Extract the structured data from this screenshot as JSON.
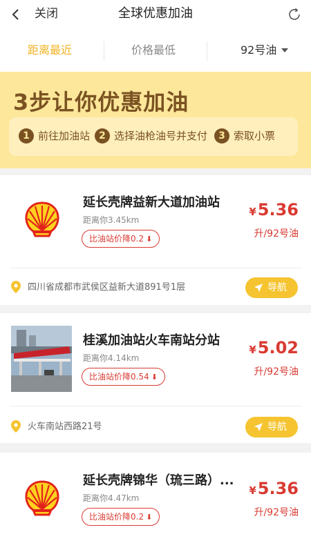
{
  "header": {
    "close_label": "关闭",
    "title": "全球优惠加油"
  },
  "filters": {
    "tabs": [
      {
        "label": "距离最近",
        "active": true
      },
      {
        "label": "价格最低",
        "active": false
      },
      {
        "label": "92号油",
        "active": false
      }
    ]
  },
  "banner": {
    "title": "3步让你优惠加油",
    "steps": [
      {
        "num": "1",
        "text": "前往加油站"
      },
      {
        "num": "2",
        "text": "选择油枪油号并支付"
      },
      {
        "num": "3",
        "text": "索取小票"
      }
    ]
  },
  "stations": [
    {
      "name": "延长壳牌益新大道加油站",
      "distance": "距离你3.45km",
      "discount": "比油站价降0.2",
      "price_symbol": "¥",
      "price": "5.36",
      "unit": "升/92号油",
      "address": "四川省成都市武侯区益新大道891号1层",
      "nav_label": "导航",
      "image": "shell-logo"
    },
    {
      "name": "桂溪加油站火车南站分站",
      "distance": "距离你4.14km",
      "discount": "比油站价降0.54",
      "price_symbol": "¥",
      "price": "5.02",
      "unit": "升/92号油",
      "address": "火车南站西路21号",
      "nav_label": "导航",
      "image": "station-photo"
    },
    {
      "name": "延长壳牌锦华（琉三路）...",
      "distance": "距离你4.47km",
      "discount": "比油站价降0.2",
      "price_symbol": "¥",
      "price": "5.36",
      "unit": "升/92号油",
      "image": "shell-logo"
    }
  ],
  "colors": {
    "accent": "#f0b322",
    "price": "#d93a32",
    "banner": "#fde79a",
    "banner_text": "#7a5222",
    "nav_button": "#f5c430"
  }
}
